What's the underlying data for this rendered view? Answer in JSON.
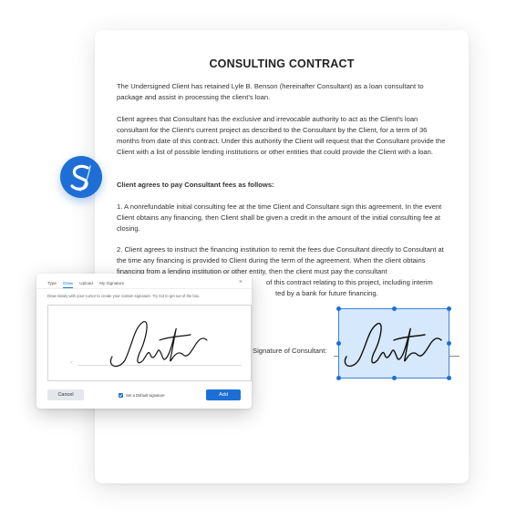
{
  "document": {
    "title": "CONSULTING CONTRACT",
    "paragraphs": [
      "The Undersigned Client has retained Lyle B. Benson (hereinafter Consultant) as a loan consultant to package and assist in processing the client's loan.",
      "Client agrees that Consultant has the exclusive and irrevocable authority to act as the Client's loan consultant for the Client's current project as described to the Consultant by the Client, for a term of 36 months from date of this contract. Under this authority the Client will request that the Consultant provide the Client with a list of possible lending institutions or other entities that could provide the Client with a loan.",
      "Client agrees to pay Consultant fees as follows:",
      "1. A nonrefundable initial consulting fee at the time Client and Consultant sign this agreement. In the event Client obtains any financing, then Client shall be given  a credit in the amount of the initial consulting fee at closing.",
      "2. Client agrees to instruct the financing institution to remit the fees due Consultant directly to Consultant at the time any financing is provided to Client during the term of the agreement. When the client obtains financing from a lending institution or other entity, then the client must pay the consultant",
      "of this contract relating to this project, including interim",
      "ted by a bank for future financing."
    ],
    "signature_label": "Signature of Consultant:"
  },
  "dialog": {
    "tabs": [
      "Type",
      "Draw",
      "Upload",
      "My Signature"
    ],
    "active_tab": "Draw",
    "close_icon": "close-icon",
    "instructions": "Draw slowly with your cursor to create your custom signature. Try not to get out of the box.",
    "baseline_mark": "×",
    "cancel_label": "Cancel",
    "default_label": "Set a Default signature",
    "default_checked": true,
    "add_label": "Add"
  },
  "logo": {
    "letter": "S",
    "color": "#1d6fd6"
  },
  "colors": {
    "accent": "#1d6fd6",
    "selection_fill": "#d6e8fb"
  }
}
